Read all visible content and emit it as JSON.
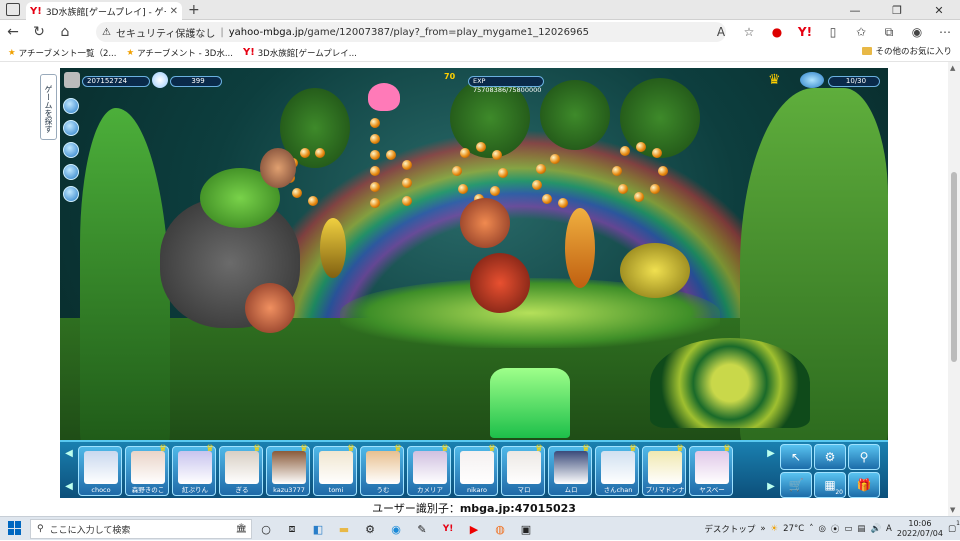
{
  "browser": {
    "tab_title": "3D水族館[ゲームプレイ] - ゲームならMo",
    "address": {
      "security": "セキュリティ保護なし",
      "url_host": "yahoo-mbga.jp",
      "url_path": "/game/12007387/play?_from=play_mygame1_12026965"
    },
    "bookmarks": [
      {
        "label": "アチーブメント一覧（2..."
      },
      {
        "label": "アチーブメント - 3D水..."
      },
      {
        "label": "3D水族館[ゲームプレイ..."
      }
    ],
    "other_bookmarks": "その他のお気に入り"
  },
  "game": {
    "hud": {
      "coins": "207152724",
      "gems": "399",
      "level": "70",
      "exp": "EXP 75708386/75800000",
      "tank": "10/30"
    },
    "side_tab_label": "ゲームを探す",
    "tank_text": "choco",
    "friends": [
      {
        "name": "choco",
        "color": "#c9d8ee"
      },
      {
        "name": "森野きのこ",
        "color": "#e9d4c8"
      },
      {
        "name": "紅ぷりん",
        "color": "#c8c4ee"
      },
      {
        "name": "ぎる",
        "color": "#d8cfc4"
      },
      {
        "name": "kazu3777",
        "color": "#8a5a3a"
      },
      {
        "name": "tomi",
        "color": "#f0e6d0"
      },
      {
        "name": "うむ",
        "color": "#e8c090"
      },
      {
        "name": "カメリア",
        "color": "#d0c0e0"
      },
      {
        "name": "nikaro",
        "color": "#f4f0f0"
      },
      {
        "name": "マロ",
        "color": "#ece8e4"
      },
      {
        "name": "ムロ",
        "color": "#3a4a7a"
      },
      {
        "name": "さんchan",
        "color": "#d0e0f0"
      },
      {
        "name": "プリマドンナ",
        "color": "#f0e8b0"
      },
      {
        "name": "ヤスベー",
        "color": "#e0c8e8"
      }
    ],
    "actions": [
      "cursor-icon",
      "camera-icon",
      "search-icon",
      "shop-icon",
      "album-icon",
      "gift-icon"
    ],
    "album_count": "20"
  },
  "user_id": {
    "label": "ユーザー識別子：",
    "value": "mbga.jp:47015023"
  },
  "taskbar": {
    "search_placeholder": "ここに入力して検索",
    "desktop_label": "デスクトップ",
    "temperature": "27°C",
    "ime": "A",
    "time": "10:06",
    "date": "2022/07/04",
    "notification_count": "1"
  }
}
